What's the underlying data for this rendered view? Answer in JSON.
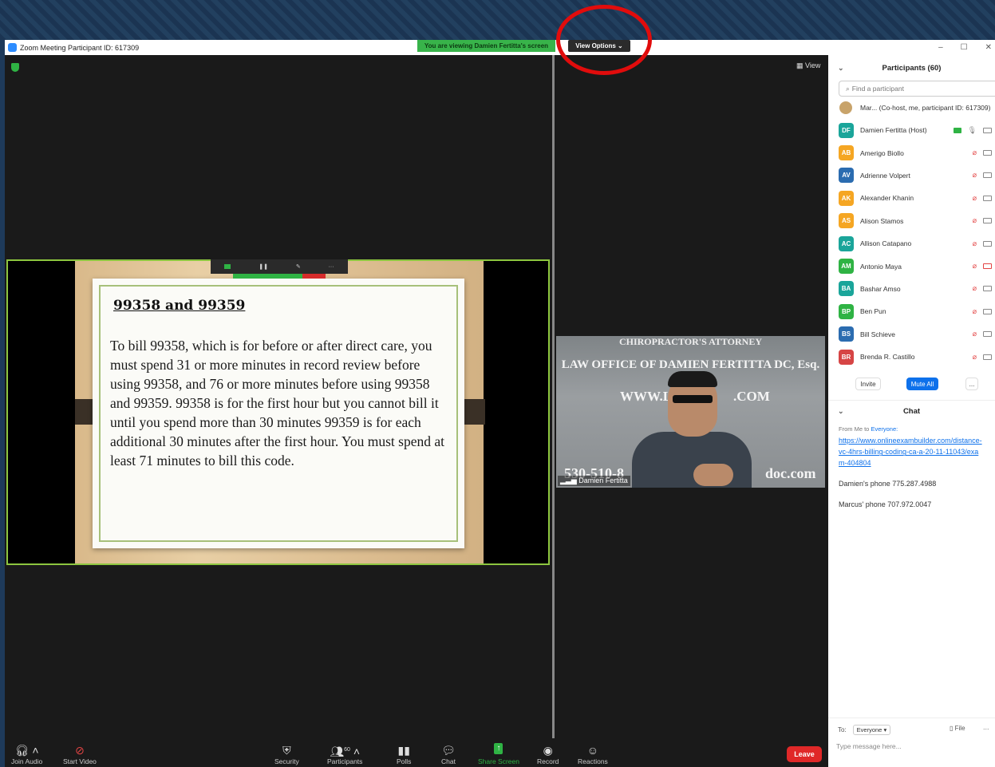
{
  "window": {
    "title": "Zoom Meeting Participant ID: 617309",
    "viewing_banner": "You are viewing Damien Fertitta's screen",
    "view_options": "View Options ⌄",
    "view_label": "View",
    "minimize": "–",
    "maximize": "☐",
    "close": "✕"
  },
  "slide": {
    "title": "99358 and 99359",
    "body": "To bill 99358, which is for before or after direct care, you must spend 31 or more minutes in record review before using 99358, and 76 or more minutes before using 99358 and 99359. 99358 is for the first hour but you cannot bill it until you spend more than 30 minutes 99359 is for each additional 30 minutes after the first hour. You must spend at least 71 minutes to bill this code."
  },
  "video": {
    "banner_top": "CHIROPRACTOR'S ATTORNEY",
    "law_office": "LAW OFFICE OF DAMIEN FERTITTA DC, Esq.",
    "www": "WWW.LAW",
    "com": ".COM",
    "phone": "530-510-8",
    "doc": "doc.com",
    "name": "Damien Fertitta"
  },
  "toolbar": {
    "join_audio": "Join Audio",
    "start_video": "Start Video",
    "security": "Security",
    "participants": "Participants",
    "participants_count": "60",
    "polls": "Polls",
    "chat": "Chat",
    "share_screen": "Share Screen",
    "record": "Record",
    "reactions": "Reactions",
    "leave": "Leave"
  },
  "participants_panel": {
    "title": "Participants (60)",
    "search_placeholder": "Find a participant",
    "me": "Mar...  (Co-host, me, participant ID: 617309)",
    "list": [
      {
        "initials": "DF",
        "name": "Damien Fertitta (Host)",
        "color": "#1aa59a"
      },
      {
        "initials": "AB",
        "name": "Amerigo Biollo",
        "color": "#f5a623"
      },
      {
        "initials": "AV",
        "name": "Adrienne Volpert",
        "color": "#2b6cb0"
      },
      {
        "initials": "AK",
        "name": "Alexander Khanin",
        "color": "#f5a623"
      },
      {
        "initials": "AS",
        "name": "Alison Stamos",
        "color": "#f5a623"
      },
      {
        "initials": "AC",
        "name": "Allison Catapano",
        "color": "#1aa59a"
      },
      {
        "initials": "AM",
        "name": "Antonio Maya",
        "color": "#2fb344"
      },
      {
        "initials": "BA",
        "name": "Bashar Amso",
        "color": "#1aa59a"
      },
      {
        "initials": "BP",
        "name": "Ben Pun",
        "color": "#2fb344"
      },
      {
        "initials": "BS",
        "name": "Bill Schieve",
        "color": "#2b6cb0"
      },
      {
        "initials": "BR",
        "name": "Brenda R. Castillo",
        "color": "#d64545"
      }
    ],
    "invite": "Invite",
    "mute_all": "Mute All",
    "more": "..."
  },
  "chat_panel": {
    "title": "Chat",
    "from_prefix": "From Me to",
    "from_target": "Everyone:",
    "link": "https://www.onlineexambuilder.com/distance-vc-4hrs-billing-coding-ca-a-20-11-11043/exam-404804",
    "msg1": "Damien's phone 775.287.4988",
    "msg2": "Marcus' phone 707.972.0047",
    "to_label": "To:",
    "to_value": "Everyone ▾",
    "file": "File",
    "more": "...",
    "input_placeholder": "Type message here..."
  },
  "colors": {
    "accent_blue": "#0e71eb",
    "share_green": "#2fb344",
    "leave_red": "#e02828",
    "annotation_red": "#e10c0c"
  }
}
